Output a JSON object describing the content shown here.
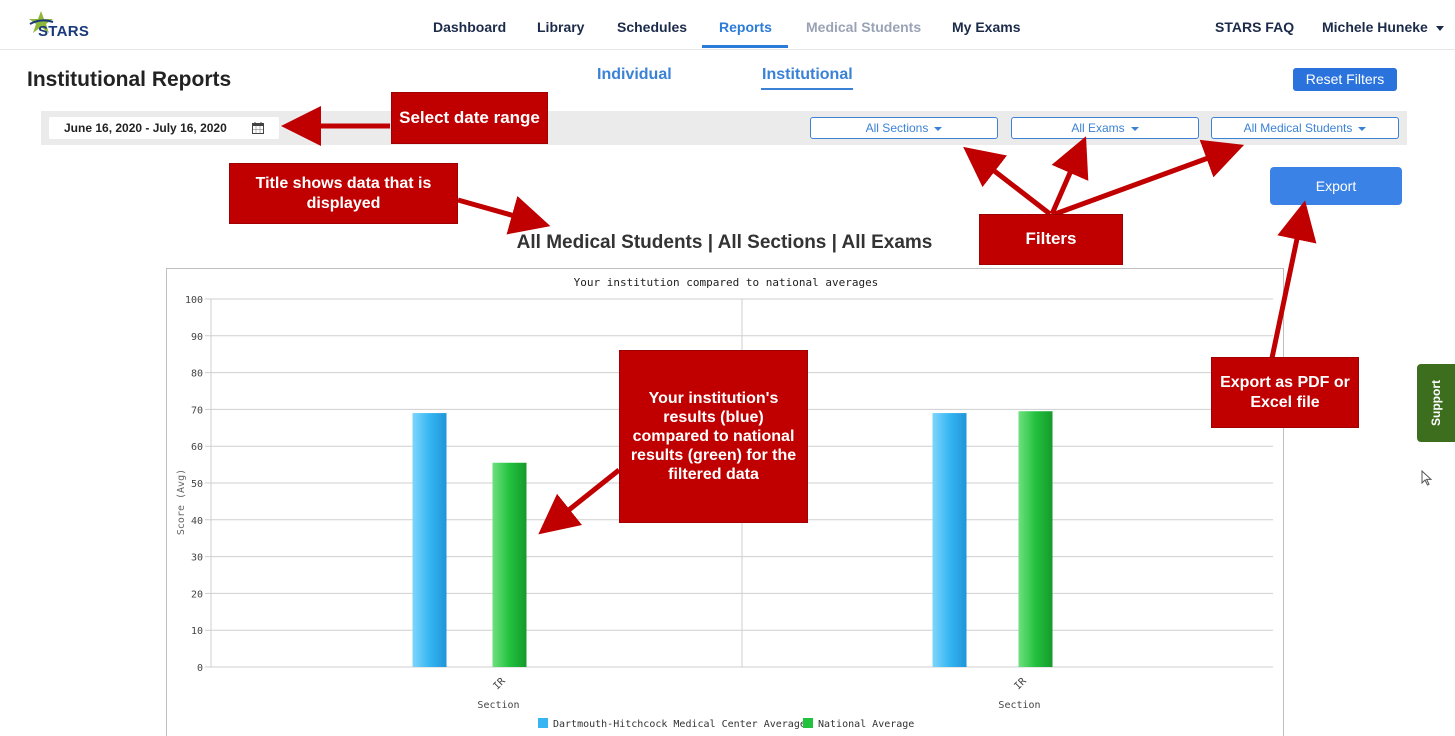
{
  "app": {
    "logo_text": "STARS"
  },
  "nav": {
    "items": [
      {
        "label": "Dashboard"
      },
      {
        "label": "Library"
      },
      {
        "label": "Schedules"
      },
      {
        "label": "Reports"
      },
      {
        "label": "Medical Students"
      },
      {
        "label": "My Exams"
      }
    ],
    "faq": "STARS FAQ",
    "user": "Michele Huneke"
  },
  "header": {
    "title": "Institutional Reports",
    "tabs": [
      {
        "label": "Individual"
      },
      {
        "label": "Institutional"
      }
    ],
    "reset_label": "Reset Filters"
  },
  "filters": {
    "date_range": "June 16, 2020 - July 16, 2020",
    "sections": "All Sections",
    "exams": "All Exams",
    "students": "All Medical Students"
  },
  "export_label": "Export",
  "report_heading": "All Medical Students | All Sections | All Exams",
  "chart_data": {
    "type": "bar",
    "title": "Your institution compared to national averages",
    "ylabel": "Score (Avg)",
    "xlabel": "Section",
    "ylim": [
      0,
      100
    ],
    "yticks": [
      0,
      10,
      20,
      30,
      40,
      50,
      60,
      70,
      80,
      90,
      100
    ],
    "categories": [
      "IR",
      "IR"
    ],
    "series": [
      {
        "name": "Dartmouth-Hitchcock Medical Center Average",
        "color": "#35b6f2",
        "values": [
          69,
          69
        ]
      },
      {
        "name": "National Average",
        "color": "#22c13e",
        "values": [
          55.5,
          69.5
        ]
      }
    ]
  },
  "annotations": {
    "date": "Select date range",
    "title": "Title shows data that is displayed",
    "filters": "Filters",
    "results": "Your institution's results (blue) compared to national results (green) for the filtered data",
    "export": "Export as PDF or Excel file"
  },
  "support_label": "Support",
  "colors": {
    "brand_blue": "#2b73dc",
    "callout_red": "#c00000",
    "support_green": "#3d6e1e"
  }
}
